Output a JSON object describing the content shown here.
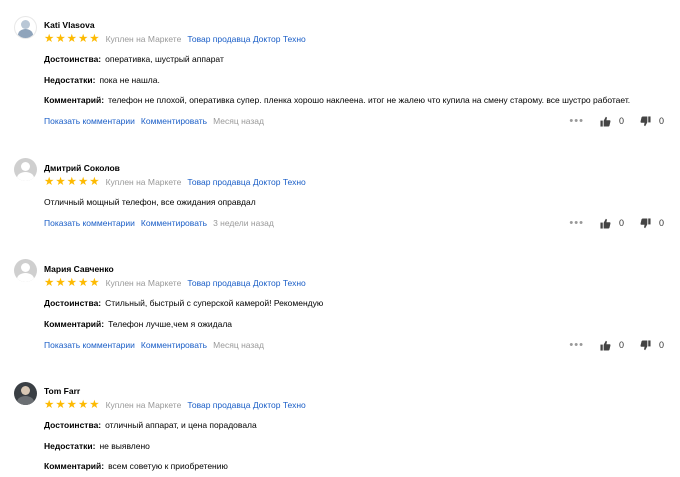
{
  "reviews": [
    {
      "name": "Kati Vlasova",
      "bought": "Куплен на Маркете",
      "seller": "Товар продавца Доктор Техно",
      "rating": 5,
      "lines": [
        {
          "label": "Достоинства:",
          "text": "оперативка, шустрый аппарат"
        },
        {
          "label": "Недостатки:",
          "text": "пока не нашла."
        },
        {
          "label": "Комментарий:",
          "text": "телефон не плохой, оперативка супер. пленка хорошо наклеена. итог не жалею что купила на смену старому. все шустро работает."
        }
      ],
      "show_comments": "Показать комментарии",
      "comment": "Комментировать",
      "date": "Месяц назад",
      "likes": "0",
      "dislikes": "0"
    },
    {
      "name": "Дмитрий Соколов",
      "bought": "Куплен на Маркете",
      "seller": "Товар продавца Доктор Техно",
      "rating": 5,
      "text": "Отличный мощный телефон, все ожидания оправдал",
      "show_comments": "Показать комментарии",
      "comment": "Комментировать",
      "date": "3 недели назад",
      "likes": "0",
      "dislikes": "0"
    },
    {
      "name": "Мария Савченко",
      "bought": "Куплен на Маркете",
      "seller": "Товар продавца Доктор Техно",
      "rating": 5,
      "lines": [
        {
          "label": "Достоинства:",
          "text": "Стильный, быстрый с суперской камерой! Рекомендую"
        },
        {
          "label": "Комментарий:",
          "text": "Телефон лучше,чем я ожидала"
        }
      ],
      "show_comments": "Показать комментарии",
      "comment": "Комментировать",
      "date": "Месяц назад",
      "likes": "0",
      "dislikes": "0"
    },
    {
      "name": "Tom Farr",
      "bought": "Куплен на Маркете",
      "seller": "Товар продавца Доктор Техно",
      "rating": 5,
      "lines": [
        {
          "label": "Достоинства:",
          "text": "отличный аппарат, и цена порадовала"
        },
        {
          "label": "Недостатки:",
          "text": "не выявлено"
        },
        {
          "label": "Комментарий:",
          "text": "всем советую к приобретению"
        }
      ]
    }
  ],
  "icons": {
    "star": "star-icon",
    "more": "more-dots-icon",
    "like": "thumbs-up-icon",
    "dislike": "thumbs-down-icon",
    "avatar": "user-avatar-icon"
  },
  "colors": {
    "star": "#fdba02",
    "link": "#1a5ec7",
    "muted": "#999999"
  }
}
